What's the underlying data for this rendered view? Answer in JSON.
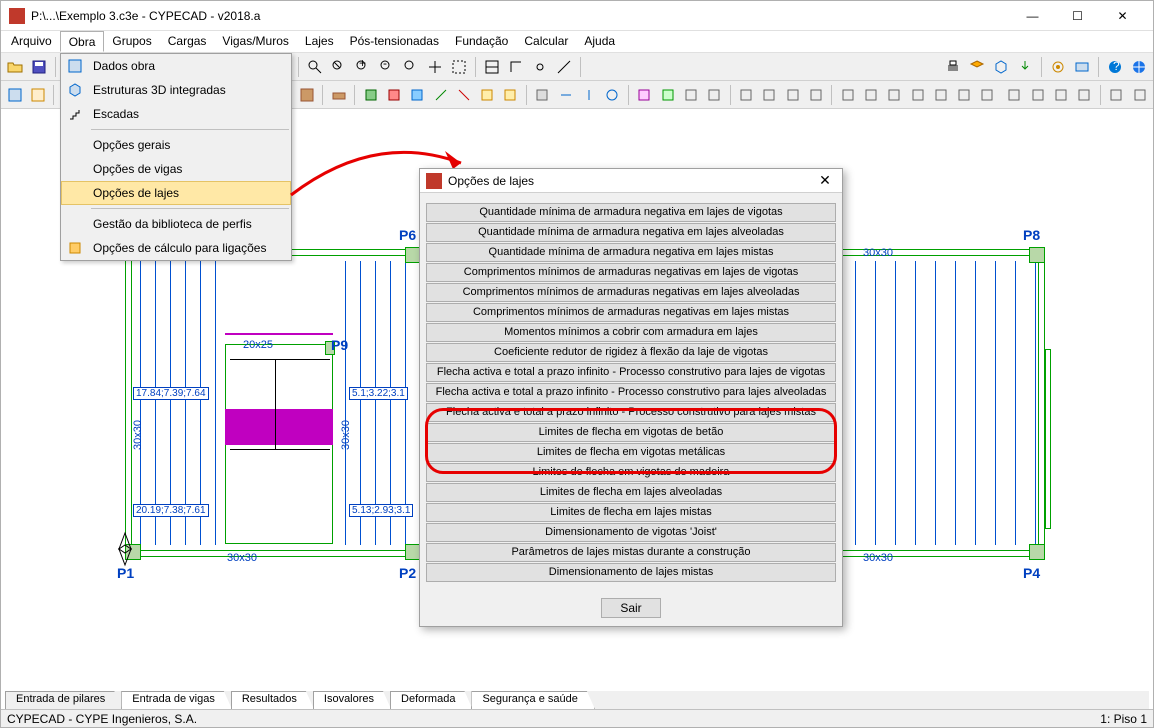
{
  "window": {
    "title": "P:\\...\\Exemplo 3.c3e - CYPECAD - v2018.a",
    "min": "—",
    "max": "☐",
    "close": "✕"
  },
  "menus": [
    "Arquivo",
    "Obra",
    "Grupos",
    "Cargas",
    "Vigas/Muros",
    "Lajes",
    "Pós-tensionadas",
    "Fundação",
    "Calcular",
    "Ajuda"
  ],
  "dropdown": {
    "items": [
      {
        "label": "Dados obra",
        "icon": true
      },
      {
        "label": "Estruturas 3D integradas",
        "icon": true
      },
      {
        "label": "Escadas",
        "icon": true
      },
      {
        "sep": true
      },
      {
        "label": "Opções gerais"
      },
      {
        "label": "Opções de vigas"
      },
      {
        "label": "Opções de lajes",
        "sel": true
      },
      {
        "sep": true
      },
      {
        "label": "Gestão da biblioteca de perfis"
      },
      {
        "label": "Opções de cálculo para ligações",
        "icon": true
      }
    ]
  },
  "dialog": {
    "title": "Opções de lajes",
    "buttons": [
      "Quantidade mínima de armadura negativa em lajes de vigotas",
      "Quantidade mínima de armadura negativa em lajes alveoladas",
      "Quantidade mínima de armadura negativa em lajes mistas",
      "Comprimentos mínimos de armaduras negativas em lajes de vigotas",
      "Comprimentos mínimos de armaduras negativas em lajes alveoladas",
      "Comprimentos mínimos de armaduras negativas em lajes mistas",
      "Momentos mínimos a cobrir com armadura em lajes",
      "Coeficiente redutor de rigidez à flexão da laje de vigotas",
      "Flecha activa e total a prazo infinito - Processo construtivo para lajes de vigotas",
      "Flecha activa e total a prazo infinito - Processo construtivo para lajes alveoladas",
      "Flecha activa e total a prazo infinito - Processo construtivo para lajes mistas",
      "Limites de flecha em vigotas de betão",
      "Limites de flecha em vigotas metálicas",
      "Limites de flecha em vigotas de madeira",
      "Limites de flecha em lajes alveoladas",
      "Limites de flecha em lajes mistas",
      "Dimensionamento de vigotas 'Joist'",
      "Parâmetros de lajes mistas durante a construção",
      "Dimensionamento de lajes mistas"
    ],
    "exit": "Sair",
    "close": "✕"
  },
  "tabs": [
    "Entrada de pilares",
    "Entrada de vigas",
    "Resultados",
    "Isovalores",
    "Deformada",
    "Segurança e saúde"
  ],
  "status": {
    "left": "CYPECAD - CYPE Ingenieros, S.A.",
    "right": "1: Piso 1"
  },
  "drawing": {
    "p1": "P1",
    "p2": "P2",
    "p4": "P4",
    "p6": "P6",
    "p8": "P8",
    "p9": "P9",
    "d20x25": "20x25",
    "d30x30_1": "30x30",
    "d30x30_2": "30x30",
    "d30x30_3": "30x30",
    "d30x30_4": "30x30",
    "d30x30_5": "30x30",
    "dim1": "17.84;7.39;7.64",
    "dim2": "20.19;7.38;7.61",
    "dim3": "5.1;3.22;3.1",
    "dim4": "5.13;2.93;3.1"
  }
}
